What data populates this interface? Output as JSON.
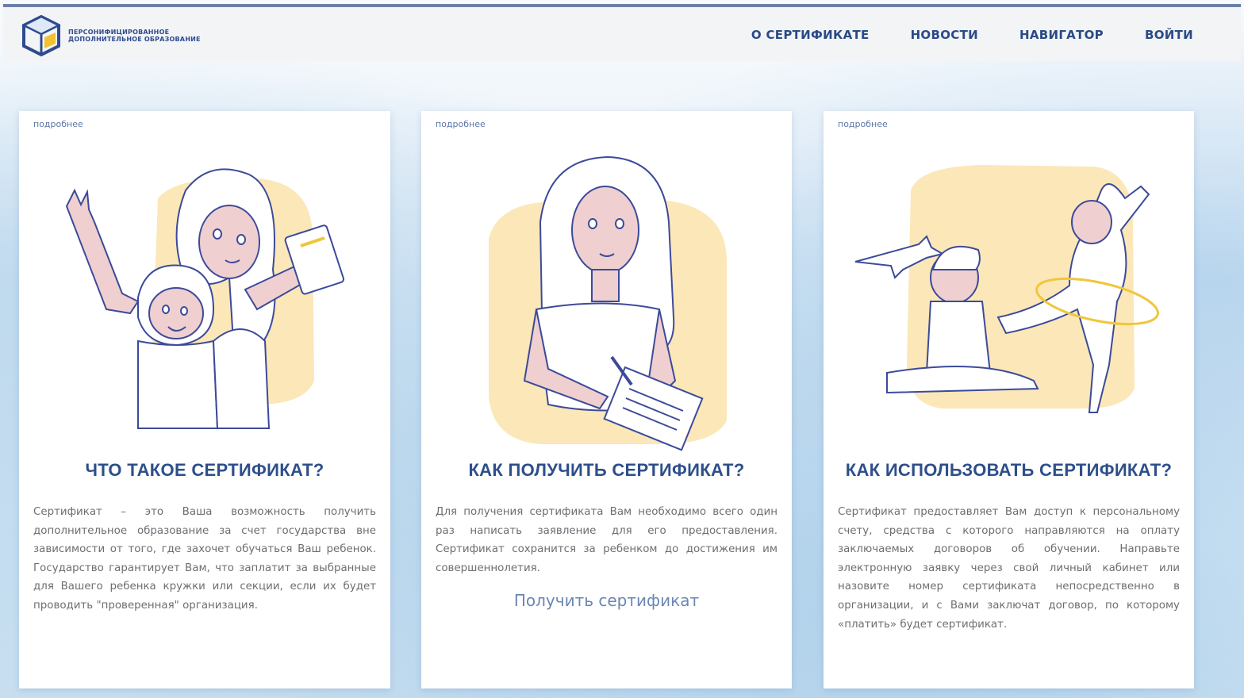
{
  "header": {
    "logo_text": "Персонифицированное дополнительное образование",
    "nav": [
      "О СЕРТИФИКАТЕ",
      "НОВОСТИ",
      "НАВИГАТОР",
      "ВОЙТИ"
    ]
  },
  "colors": {
    "accent": "#2d4f8a",
    "blob": "#fbe7b8",
    "line": "#3c4a9a"
  },
  "cards": [
    {
      "more": "подробнее",
      "title": "ЧТО ТАКОЕ СЕРТИФИКАТ?",
      "text": "Сертификат – это Ваша возможность получить дополнительное образование за счет государства вне зависимости от того, где захочет обучаться Ваш ребенок. Государство гарантирует Вам, что заплатит за выбранные для Вашего ребенка кружки или секции, если их будет проводить \"проверенная\" организация."
    },
    {
      "more": "подробнее",
      "title": "КАК ПОЛУЧИТЬ СЕРТИФИКАТ?",
      "text": "Для получения сертификата Вам необходимо всего один раз написать заявление для его предоставления. Сертификат сохранится за ребенком до достижения им совершеннолетия.",
      "link": "Получить сертификат"
    },
    {
      "more": "подробнее",
      "title": "КАК ИСПОЛЬЗОВАТЬ СЕРТИФИКАТ?",
      "text": "Сертификат предоставляет Вам доступ к персональному счету, средства с которого направляются на оплату заключаемых договоров об обучении. Направьте электронную заявку через свой личный кабинет или назовите номер сертификата непосредственно в организации, и с Вами заключат договор, по которому «платить» будет сертификат."
    }
  ]
}
